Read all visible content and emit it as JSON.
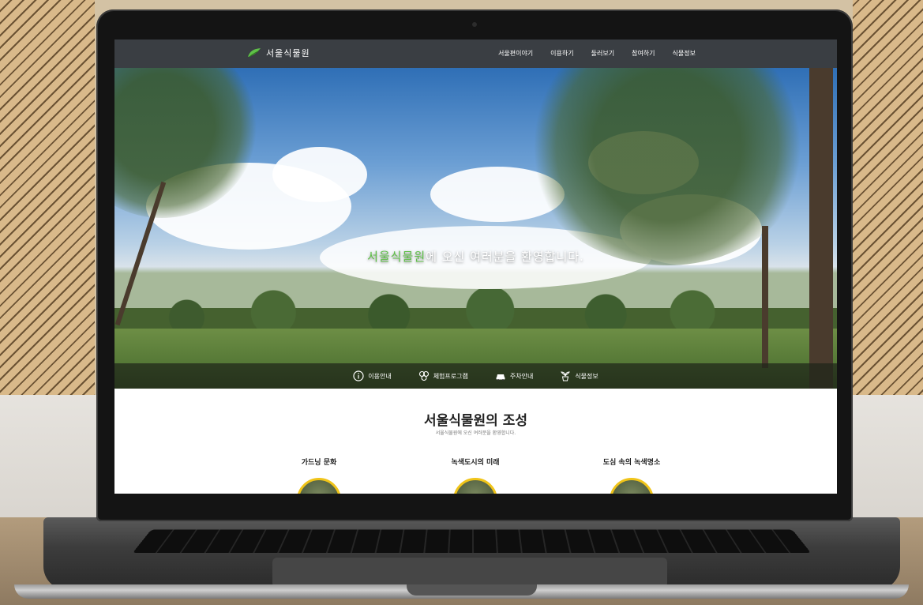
{
  "site": {
    "logo_text": "서울식물원",
    "nav": [
      "서울편이야기",
      "이용하기",
      "둘러보기",
      "참여하기",
      "식물정보"
    ],
    "hero": {
      "highlight": "서울식물원",
      "message": "에 오신 여러분을 환영합니다."
    },
    "quick_links": [
      {
        "label": "이용안내",
        "icon": "info-icon"
      },
      {
        "label": "체험프로그램",
        "icon": "program-icon"
      },
      {
        "label": "주차안내",
        "icon": "car-icon"
      },
      {
        "label": "식물정보",
        "icon": "plant-pot-icon"
      }
    ],
    "section": {
      "title": "서울식물원의 조성",
      "subtitle": "서울식물원에 오신 여러분을 환영합니다.",
      "cards": [
        "가드닝 문화",
        "녹색도시의 미래",
        "도심 속의 녹색명소"
      ]
    }
  },
  "colors": {
    "header_bg": "#3a3e43",
    "accent_green": "#5fc048",
    "thumb_border": "#f0c419"
  }
}
